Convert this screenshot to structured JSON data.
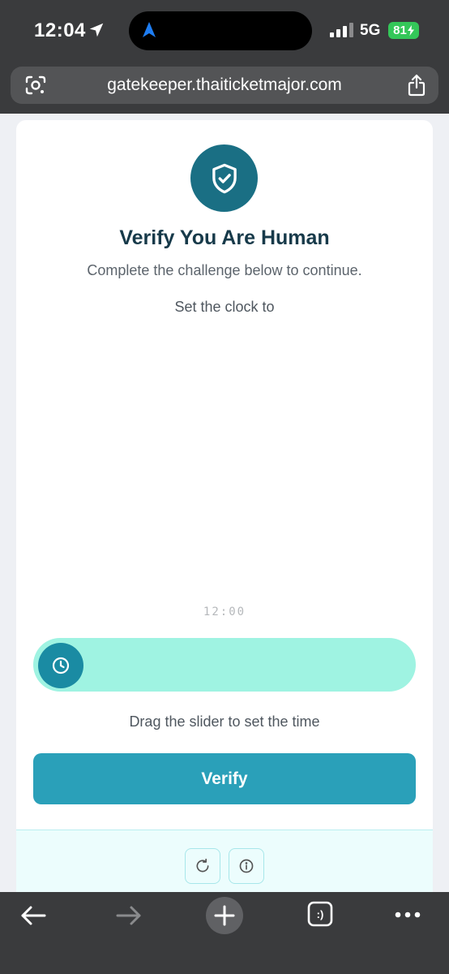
{
  "status_bar": {
    "time": "12:04",
    "network": "5G",
    "battery": "81"
  },
  "browser": {
    "url": "gatekeeper.thaiticketmajor.com"
  },
  "challenge": {
    "title": "Verify You Are Human",
    "subtitle": "Complete the challenge below to continue.",
    "instruction": "Set the clock to",
    "time_readout": "12:00",
    "slider_position": 0,
    "slider_hint": "Drag the slider to set the time",
    "verify_label": "Verify"
  },
  "icons": {
    "badge": "shield-check-icon",
    "slider_handle": "clock-icon",
    "footer": [
      "refresh-icon",
      "info-icon"
    ],
    "toolbar": [
      "back-arrow-icon",
      "forward-arrow-icon",
      "plus-icon",
      "tabs-icon",
      "more-icon"
    ]
  },
  "colors": {
    "accent": "#2aa0b9",
    "badge": "#1a6f84",
    "slider_track": "#9ff3e2",
    "title": "#173a4a",
    "battery": "#34c759"
  }
}
